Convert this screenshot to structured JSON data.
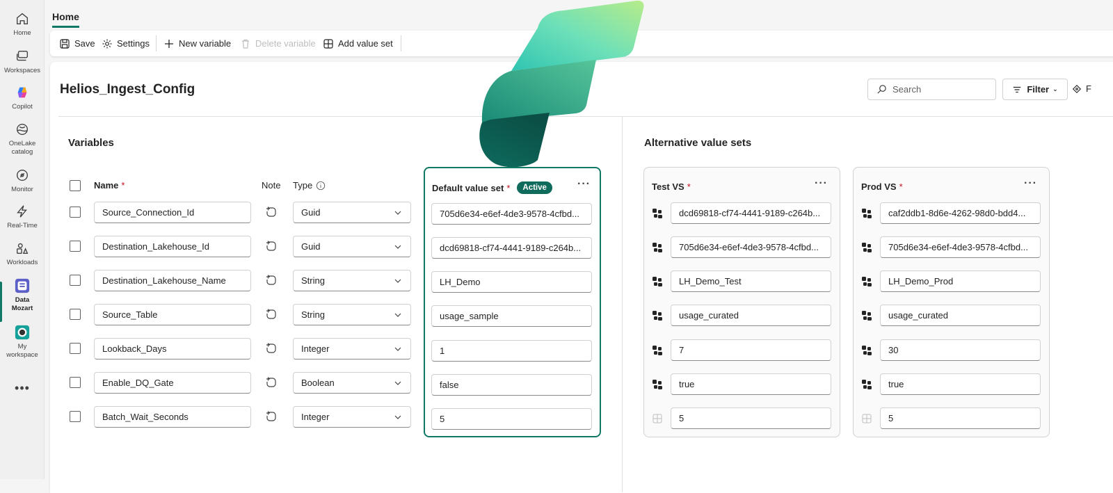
{
  "rail": {
    "items": [
      {
        "label": "Home",
        "icon": "home-icon"
      },
      {
        "label": "Workspaces",
        "icon": "workspaces-icon"
      },
      {
        "label": "Copilot",
        "icon": "copilot-icon"
      },
      {
        "label": "OneLake catalog",
        "icon": "onelake-icon"
      },
      {
        "label": "Monitor",
        "icon": "monitor-icon"
      },
      {
        "label": "Real-Time",
        "icon": "lightning-icon"
      },
      {
        "label": "Workloads",
        "icon": "workloads-icon"
      },
      {
        "label": "Data Mozart",
        "icon": "workspace-app-icon"
      },
      {
        "label": "My workspace",
        "icon": "my-workspace-icon"
      }
    ],
    "more_label": "•••"
  },
  "tabs": {
    "home": "Home"
  },
  "ribbon": {
    "save": "Save",
    "settings": "Settings",
    "new_variable": "New variable",
    "delete_variable": "Delete variable",
    "add_value_set": "Add value set"
  },
  "page": {
    "title": "Helios_Ingest_Config",
    "search_placeholder": "Search",
    "filter_label": "Filter",
    "extra_label": "F"
  },
  "variables": {
    "section_title": "Variables",
    "headers": {
      "name": "Name",
      "note": "Note",
      "type": "Type",
      "required_mark": "*"
    },
    "rows": [
      {
        "name": "Source_Connection_Id",
        "type": "Guid"
      },
      {
        "name": "Destination_Lakehouse_Id",
        "type": "Guid"
      },
      {
        "name": "Destination_Lakehouse_Name",
        "type": "String"
      },
      {
        "name": "Source_Table",
        "type": "String"
      },
      {
        "name": "Lookback_Days",
        "type": "Integer"
      },
      {
        "name": "Enable_DQ_Gate",
        "type": "Boolean"
      },
      {
        "name": "Batch_Wait_Seconds",
        "type": "Integer"
      }
    ]
  },
  "default_set": {
    "title": "Default value set",
    "badge": "Active",
    "more": "···",
    "values": [
      "705d6e34-e6ef-4de3-9578-4cfbd...",
      "dcd69818-cf74-4441-9189-c264b...",
      "LH_Demo",
      "usage_sample",
      "1",
      "false",
      "5"
    ]
  },
  "alternatives": {
    "section_title": "Alternative value sets",
    "sets": [
      {
        "title": "Test VS",
        "more": "···",
        "values": [
          "dcd69818-cf74-4441-9189-c264b...",
          "705d6e34-e6ef-4de3-9578-4cfbd...",
          "LH_Demo_Test",
          "usage_curated",
          "7",
          "true",
          "5"
        ]
      },
      {
        "title": "Prod VS",
        "more": "···",
        "values": [
          "caf2ddb1-8d6e-4262-98d0-bdd4...",
          "705d6e34-e6ef-4de3-9578-4cfbd...",
          "LH_Demo_Prod",
          "usage_curated",
          "30",
          "true",
          "5"
        ]
      }
    ]
  },
  "colors": {
    "accent": "#117865",
    "badge": "#0f6b5b",
    "required": "#c50f1f"
  }
}
